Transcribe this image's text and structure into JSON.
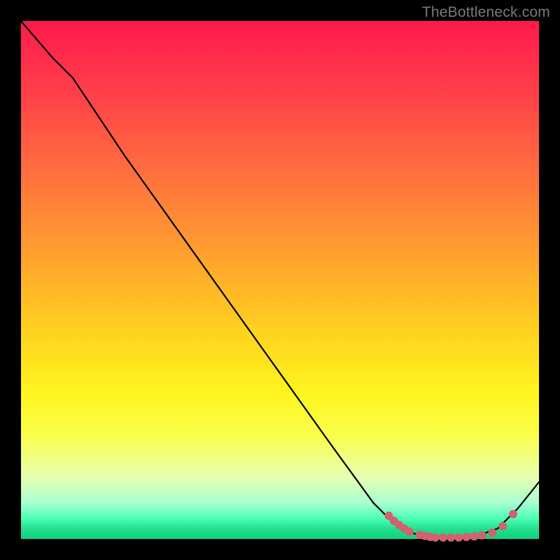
{
  "watermark": "TheBottleneck.com",
  "chart_data": {
    "type": "line",
    "title": "",
    "xlabel": "",
    "ylabel": "",
    "xlim": [
      0,
      100
    ],
    "ylim": [
      0,
      100
    ],
    "grid": false,
    "series": [
      {
        "name": "curve",
        "points": [
          {
            "x": 0,
            "y": 100
          },
          {
            "x": 6,
            "y": 93
          },
          {
            "x": 10,
            "y": 89
          },
          {
            "x": 20,
            "y": 74
          },
          {
            "x": 30,
            "y": 60
          },
          {
            "x": 40,
            "y": 46
          },
          {
            "x": 50,
            "y": 32
          },
          {
            "x": 60,
            "y": 18
          },
          {
            "x": 68,
            "y": 7
          },
          {
            "x": 72,
            "y": 3
          },
          {
            "x": 76,
            "y": 1
          },
          {
            "x": 80,
            "y": 0.3
          },
          {
            "x": 84,
            "y": 0.3
          },
          {
            "x": 88,
            "y": 0.6
          },
          {
            "x": 92,
            "y": 2
          },
          {
            "x": 96,
            "y": 6
          },
          {
            "x": 100,
            "y": 11
          }
        ]
      },
      {
        "name": "dots",
        "points": [
          {
            "x": 71,
            "y": 4.5
          },
          {
            "x": 72,
            "y": 3.5
          },
          {
            "x": 73,
            "y": 2.7
          },
          {
            "x": 74,
            "y": 2.0
          },
          {
            "x": 75,
            "y": 1.4
          },
          {
            "x": 77,
            "y": 0.8
          },
          {
            "x": 78,
            "y": 0.6
          },
          {
            "x": 79,
            "y": 0.4
          },
          {
            "x": 80,
            "y": 0.3
          },
          {
            "x": 81.5,
            "y": 0.3
          },
          {
            "x": 83,
            "y": 0.3
          },
          {
            "x": 84.5,
            "y": 0.3
          },
          {
            "x": 86,
            "y": 0.4
          },
          {
            "x": 87.5,
            "y": 0.5
          },
          {
            "x": 89,
            "y": 0.7
          },
          {
            "x": 91,
            "y": 1.2
          },
          {
            "x": 93,
            "y": 2.5
          },
          {
            "x": 95,
            "y": 4.8
          }
        ]
      }
    ]
  }
}
